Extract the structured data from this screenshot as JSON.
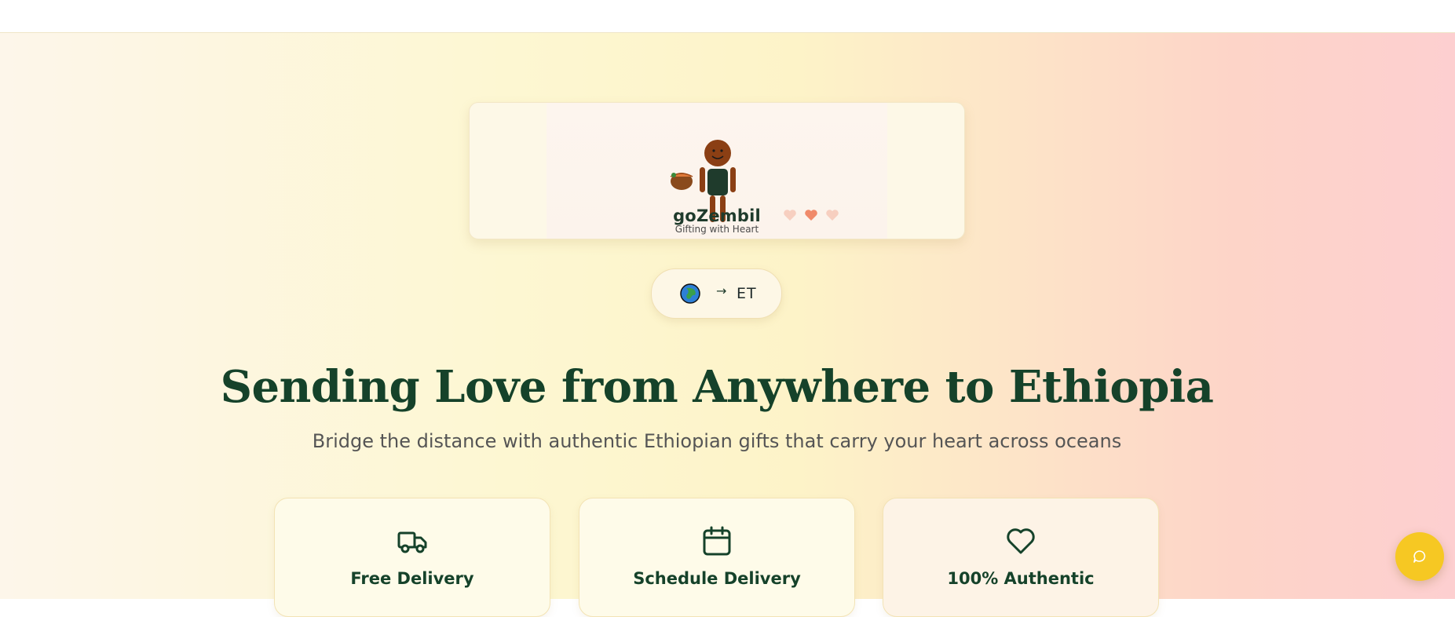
{
  "brand": {
    "name": "goZembil",
    "tagline": "Gifting with Heart"
  },
  "region_selector": {
    "from_icon": "globe-icon",
    "arrow": "→",
    "to": "ET"
  },
  "hero": {
    "headline": "Sending Love from Anywhere to Ethiopia",
    "subheadline": "Bridge the distance with authentic Ethiopian gifts that carry your heart across oceans"
  },
  "features": [
    {
      "icon": "truck-icon",
      "title": "Free Delivery"
    },
    {
      "icon": "calendar-icon",
      "title": "Schedule Delivery"
    },
    {
      "icon": "heart-icon",
      "title": "100% Authentic"
    }
  ],
  "chat": {
    "icon": "chat-bubble-icon"
  },
  "colors": {
    "brand_green": "#15422a",
    "accent_yellow": "#f6c823",
    "heart_coral": "#f08a6a"
  }
}
